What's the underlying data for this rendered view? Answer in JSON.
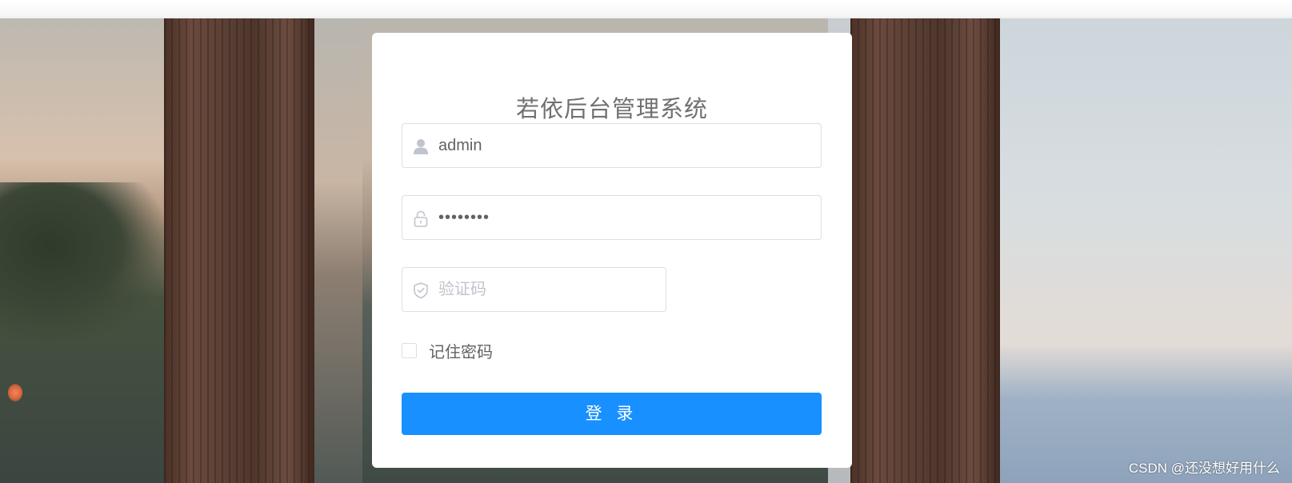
{
  "login": {
    "title": "若依后台管理系统",
    "username": {
      "value": "admin",
      "icon": "user-icon"
    },
    "password": {
      "value": "••••••••",
      "icon": "lock-icon"
    },
    "captcha": {
      "value": "",
      "placeholder": "验证码",
      "icon": "shield-icon"
    },
    "remember_label": "记住密码",
    "remember_checked": false,
    "submit_label": "登 录"
  },
  "watermark": "CSDN @还没想好用什么",
  "colors": {
    "primary": "#1890ff",
    "title_text": "#707070",
    "input_border": "#dcdfe6",
    "icon": "#c0c4cc"
  }
}
